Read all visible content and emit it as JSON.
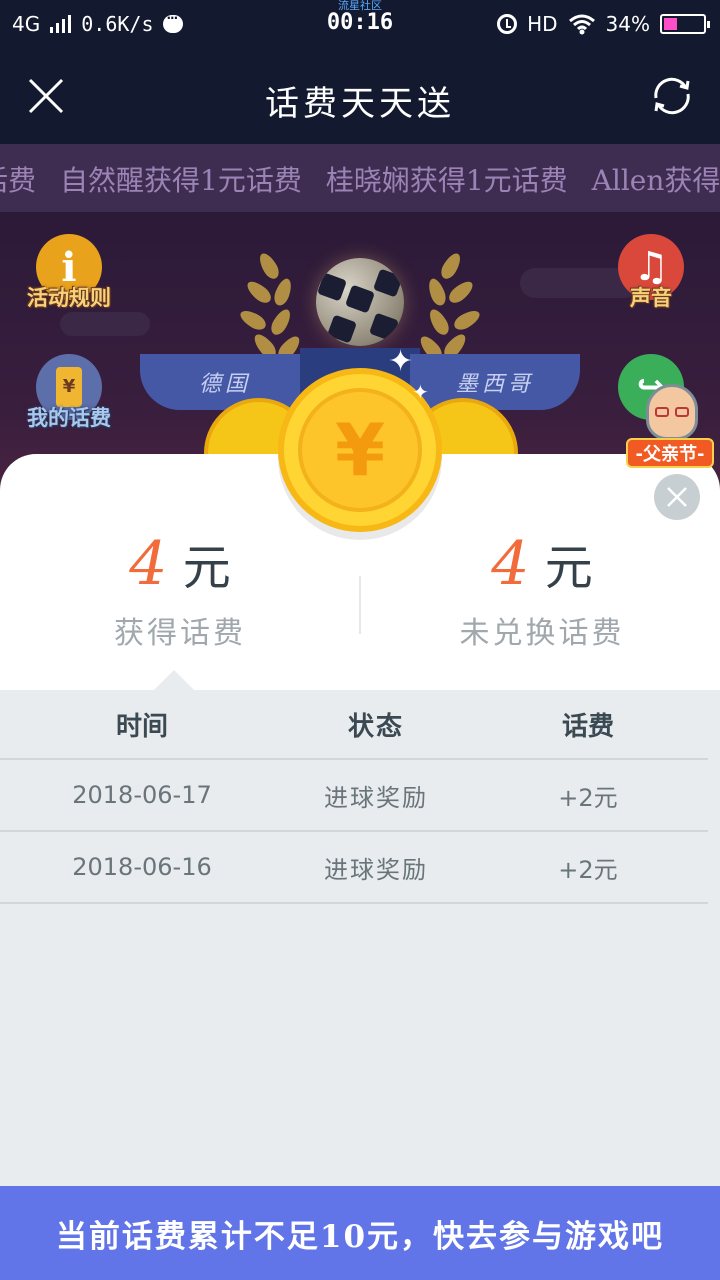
{
  "status_bar": {
    "network": "4G",
    "speed": "0.6K/s",
    "watermark": "流星社区",
    "time": "00:16",
    "hd": "HD",
    "battery": "34%",
    "battery_fraction": 0.34,
    "icons": [
      "signal-icon",
      "chat-bubble-icon",
      "alarm-icon",
      "wifi-icon",
      "battery-icon"
    ]
  },
  "header": {
    "title": "话费天天送",
    "close_icon": "close-icon",
    "refresh_icon": "refresh-icon"
  },
  "marquee": {
    "items": [
      "话费",
      "自然醒获得1元话费",
      "桂晓娴获得1元话费",
      "Allen获得"
    ]
  },
  "game": {
    "left_buttons": [
      {
        "label": "活动规则",
        "icon": "info-icon",
        "color": "#e9a21b"
      },
      {
        "label": "我的话费",
        "icon": "phone-yuan-icon",
        "color": "#5d6faa"
      }
    ],
    "right_buttons": [
      {
        "label": "声音",
        "icon": "music-note-icon",
        "color": "#d9483b"
      },
      {
        "label": "",
        "icon": "share-icon",
        "color": "#3bae5a"
      }
    ],
    "teams": {
      "left": "德国",
      "right": "墨西哥"
    },
    "badge": "-父亲节-"
  },
  "summary": {
    "earned_value": "4",
    "earned_unit": "元",
    "earned_label": "获得话费",
    "unredeemed_value": "4",
    "unredeemed_unit": "元",
    "unredeemed_label": "未兑换话费",
    "coin_symbol": "¥"
  },
  "table": {
    "headers": [
      "时间",
      "状态",
      "话费"
    ],
    "rows": [
      [
        "2018-06-17",
        "进球奖励",
        "+2元"
      ],
      [
        "2018-06-16",
        "进球奖励",
        "+2元"
      ]
    ]
  },
  "footer": {
    "message": "当前话费累计不足10元，快去参与游戏吧"
  },
  "colors": {
    "accent_orange": "#f26b3a",
    "footer_blue": "#6175e8",
    "header_dark": "#131a30",
    "coin_gold": "#ffd534"
  }
}
